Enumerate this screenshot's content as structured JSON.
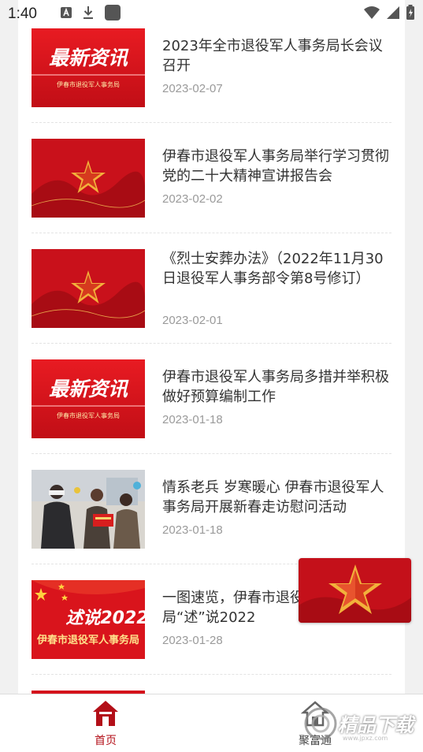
{
  "status_bar": {
    "time": "1:40",
    "icons": [
      "font-a-icon",
      "download-icon",
      "app-square-icon",
      "wifi-icon",
      "signal-icon",
      "battery-icon"
    ]
  },
  "news": [
    {
      "title": "2023年全市退役军人事务局长会议召开",
      "date": "2023-02-07",
      "thumb": "latest-news",
      "thumb_text": "最新资讯",
      "thumb_sub": "伊春市退役军人事务局"
    },
    {
      "title": "伊春市退役军人事务局举行学习贯彻党的二十大精神宣讲报告会",
      "date": "2023-02-02",
      "thumb": "star"
    },
    {
      "title": "《烈士安葬办法》（2022年11月30日退役军人事务部令第8号修订）",
      "date": "2023-02-01",
      "thumb": "star"
    },
    {
      "title": "伊春市退役军人事务局多措并举积极做好预算编制工作",
      "date": "2023-01-18",
      "thumb": "latest-news",
      "thumb_text": "最新资讯",
      "thumb_sub": "伊春市退役军人事务局"
    },
    {
      "title": "情系老兵 岁寒暖心 伊春市退役军人事务局开展新春走访慰问活动",
      "date": "2023-01-18",
      "thumb": "photo"
    },
    {
      "title": "一图速览，伊春市退役军人事务局“述”说2022",
      "date": "2023-01-28",
      "thumb": "review",
      "thumb_text": "述说2022",
      "thumb_sub": "伊春市退役军人事务局"
    }
  ],
  "tabs": [
    {
      "label": "首页",
      "icon": "home-icon",
      "active": true
    },
    {
      "label": "聚富通",
      "icon": "house-outline-icon",
      "active": false
    }
  ],
  "watermark": {
    "text": "精品下载",
    "url": "www.jpxz.com"
  },
  "colors": {
    "accent": "#b30f18",
    "thumb_red": "#d4121c"
  }
}
